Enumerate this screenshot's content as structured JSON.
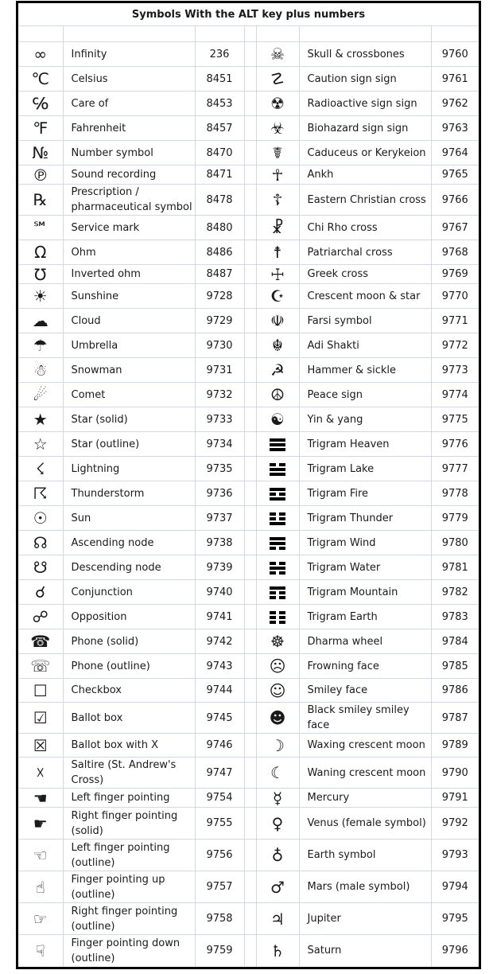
{
  "title": "Symbols With the ALT key plus numbers",
  "rows": [
    {
      "left": {
        "symbol": "∞",
        "icon": "infinity-icon",
        "name": "Infinity",
        "code": "236"
      },
      "right": {
        "symbol": "☠",
        "icon": "skull-crossbones-icon",
        "name": "Skull & crossbones",
        "code": "9760"
      }
    },
    {
      "left": {
        "symbol": "℃",
        "icon": "celsius-icon",
        "name": "Celsius",
        "code": "8451"
      },
      "right": {
        "symbol": "☡",
        "icon": "caution-sign-icon",
        "name": "Caution sign sign",
        "code": "9761"
      }
    },
    {
      "left": {
        "symbol": "℅",
        "icon": "care-of-icon",
        "name": "Care of",
        "code": "8453"
      },
      "right": {
        "symbol": "☢",
        "icon": "radioactive-icon",
        "name": "Radioactive sign sign",
        "code": "9762"
      }
    },
    {
      "left": {
        "symbol": "℉",
        "icon": "fahrenheit-icon",
        "name": "Fahrenheit",
        "code": "8457"
      },
      "right": {
        "symbol": "☣",
        "icon": "biohazard-icon",
        "name": "Biohazard sign sign",
        "code": "9763"
      }
    },
    {
      "left": {
        "symbol": "№",
        "icon": "number-symbol-icon",
        "name": "Number symbol",
        "code": "8470"
      },
      "right": {
        "symbol": "☤",
        "icon": "caduceus-icon",
        "name": "Caduceus or Kerykeion",
        "code": "9764"
      }
    },
    {
      "left": {
        "symbol": "℗",
        "icon": "sound-recording-icon",
        "name": "Sound recording",
        "code": "8471"
      },
      "right": {
        "symbol": "☥",
        "icon": "ankh-icon",
        "name": "Ankh",
        "code": "9765"
      }
    },
    {
      "left": {
        "symbol": "℞",
        "icon": "prescription-icon",
        "name": "Prescription / pharmaceutical symbol",
        "code": "8478"
      },
      "right": {
        "symbol": "☦",
        "icon": "eastern-christian-cross-icon",
        "name": "Eastern Christian cross",
        "code": "9766"
      }
    },
    {
      "left": {
        "symbol": "℠",
        "icon": "service-mark-icon",
        "name": "Service mark",
        "code": "8480"
      },
      "right": {
        "symbol": "☧",
        "icon": "chi-rho-icon",
        "name": "Chi Rho cross",
        "code": "9767"
      }
    },
    {
      "left": {
        "symbol": "Ω",
        "icon": "ohm-icon",
        "name": "Ohm",
        "code": "8486"
      },
      "right": {
        "symbol": "☨",
        "icon": "patriarchal-cross-icon",
        "name": "Patriarchal cross",
        "code": "9768"
      }
    },
    {
      "left": {
        "symbol": "℧",
        "icon": "inverted-ohm-icon",
        "name": "Inverted ohm",
        "code": "8487"
      },
      "right": {
        "symbol": "☩",
        "icon": "greek-cross-icon",
        "name": "Greek cross",
        "code": "9769"
      }
    },
    {
      "left": {
        "symbol": "☀",
        "icon": "sunshine-icon",
        "name": "Sunshine",
        "code": "9728"
      },
      "right": {
        "symbol": "☪",
        "icon": "crescent-moon-star-icon",
        "name": "Crescent moon & star",
        "code": "9770"
      }
    },
    {
      "left": {
        "symbol": "☁",
        "icon": "cloud-icon",
        "name": "Cloud",
        "code": "9729"
      },
      "right": {
        "symbol": "☫",
        "icon": "farsi-symbol-icon",
        "name": "Farsi symbol",
        "code": "9771"
      }
    },
    {
      "left": {
        "symbol": "☂",
        "icon": "umbrella-icon",
        "name": "Umbrella",
        "code": "9730"
      },
      "right": {
        "symbol": "☬",
        "icon": "adi-shakti-icon",
        "name": "Adi Shakti",
        "code": "9772"
      }
    },
    {
      "left": {
        "symbol": "☃",
        "icon": "snowman-icon",
        "name": "Snowman",
        "code": "9731"
      },
      "right": {
        "symbol": "☭",
        "icon": "hammer-sickle-icon",
        "name": "Hammer & sickle",
        "code": "9773"
      }
    },
    {
      "left": {
        "symbol": "☄",
        "icon": "comet-icon",
        "name": "Comet",
        "code": "9732"
      },
      "right": {
        "symbol": "☮",
        "icon": "peace-sign-icon",
        "name": "Peace sign",
        "code": "9774"
      }
    },
    {
      "left": {
        "symbol": "★",
        "icon": "star-solid-icon",
        "name": "Star (solid)",
        "code": "9733"
      },
      "right": {
        "symbol": "☯",
        "icon": "yin-yang-icon",
        "name": "Yin & yang",
        "code": "9775"
      }
    },
    {
      "left": {
        "symbol": "☆",
        "icon": "star-outline-icon",
        "name": "Star (outline)",
        "code": "9734"
      },
      "right": {
        "symbol": "☰",
        "icon": "trigram-heaven-icon",
        "name": "Trigram Heaven",
        "code": "9776",
        "trigram": "sss"
      }
    },
    {
      "left": {
        "symbol": "☇",
        "icon": "lightning-icon",
        "name": "Lightning",
        "code": "9735"
      },
      "right": {
        "symbol": "☱",
        "icon": "trigram-lake-icon",
        "name": "Trigram Lake",
        "code": "9777",
        "trigram": "bss"
      }
    },
    {
      "left": {
        "symbol": "☈",
        "icon": "thunderstorm-icon",
        "name": "Thunderstorm",
        "code": "9736"
      },
      "right": {
        "symbol": "☲",
        "icon": "trigram-fire-icon",
        "name": "Trigram Fire",
        "code": "9778",
        "trigram": "sbs"
      }
    },
    {
      "left": {
        "symbol": "☉",
        "icon": "sun-icon",
        "name": "Sun",
        "code": "9737"
      },
      "right": {
        "symbol": "☳",
        "icon": "trigram-thunder-icon",
        "name": "Trigram Thunder",
        "code": "9779",
        "trigram": "bbs"
      }
    },
    {
      "left": {
        "symbol": "☊",
        "icon": "ascending-node-icon",
        "name": "Ascending node",
        "code": "9738"
      },
      "right": {
        "symbol": "☴",
        "icon": "trigram-wind-icon",
        "name": "Trigram Wind",
        "code": "9780",
        "trigram": "ssb"
      }
    },
    {
      "left": {
        "symbol": "☋",
        "icon": "descending-node-icon",
        "name": "Descending node",
        "code": "9739"
      },
      "right": {
        "symbol": "☵",
        "icon": "trigram-water-icon",
        "name": "Trigram Water",
        "code": "9781",
        "trigram": "bsb"
      }
    },
    {
      "left": {
        "symbol": "☌",
        "icon": "conjunction-icon",
        "name": "Conjunction",
        "code": "9740"
      },
      "right": {
        "symbol": "☶",
        "icon": "trigram-mountain-icon",
        "name": "Trigram Mountain",
        "code": "9782",
        "trigram": "sbb"
      }
    },
    {
      "left": {
        "symbol": "☍",
        "icon": "opposition-icon",
        "name": "Opposition",
        "code": "9741"
      },
      "right": {
        "symbol": "☷",
        "icon": "trigram-earth-icon",
        "name": "Trigram Earth",
        "code": "9783",
        "trigram": "bbb"
      }
    },
    {
      "left": {
        "symbol": "☎",
        "icon": "phone-solid-icon",
        "name": "Phone (solid)",
        "code": "9742"
      },
      "right": {
        "symbol": "☸",
        "icon": "dharma-wheel-icon",
        "name": "Dharma wheel",
        "code": "9784"
      }
    },
    {
      "left": {
        "symbol": "☏",
        "icon": "phone-outline-icon",
        "name": "Phone (outline)",
        "code": "9743"
      },
      "right": {
        "symbol": "☹",
        "icon": "frowning-face-icon",
        "name": "Frowning face",
        "code": "9785"
      }
    },
    {
      "left": {
        "symbol": "☐",
        "icon": "checkbox-icon",
        "name": "Checkbox",
        "code": "9744"
      },
      "right": {
        "symbol": "☺",
        "icon": "smiley-face-icon",
        "name": "Smiley face",
        "code": "9786"
      }
    },
    {
      "left": {
        "symbol": "☑",
        "icon": "ballot-box-check-icon",
        "name": "Ballot box",
        "code": "9745"
      },
      "right": {
        "symbol": "☻",
        "icon": "black-smiley-face-icon",
        "name": "Black smiley smiley face",
        "code": "9787"
      }
    },
    {
      "left": {
        "symbol": "☒",
        "icon": "ballot-box-x-icon",
        "name": "Ballot box with X",
        "code": "9746"
      },
      "right": {
        "symbol": "☽",
        "icon": "waxing-crescent-moon-icon",
        "name": "Waxing crescent moon",
        "code": "9789"
      }
    },
    {
      "left": {
        "symbol": "☓",
        "icon": "saltire-icon",
        "name": "Saltire (St. Andrew's Cross)",
        "code": "9747"
      },
      "right": {
        "symbol": "☾",
        "icon": "waning-crescent-moon-icon",
        "name": "Waning crescent moon",
        "code": "9790"
      }
    },
    {
      "left": {
        "symbol": "☚",
        "icon": "left-finger-solid-icon",
        "name": "Left finger pointing",
        "code": "9754"
      },
      "right": {
        "symbol": "☿",
        "icon": "mercury-icon",
        "name": "Mercury",
        "code": "9791"
      }
    },
    {
      "left": {
        "symbol": "☛",
        "icon": "right-finger-solid-icon",
        "name": "Right finger pointing (solid)",
        "code": "9755"
      },
      "right": {
        "symbol": "♀",
        "icon": "venus-icon",
        "name": "Venus (female symbol)",
        "code": "9792"
      }
    },
    {
      "left": {
        "symbol": "☜",
        "icon": "left-finger-outline-icon",
        "name": "Left finger pointing (outline)",
        "code": "9756"
      },
      "right": {
        "symbol": "♁",
        "icon": "earth-symbol-icon",
        "name": "Earth symbol",
        "code": "9793"
      }
    },
    {
      "left": {
        "symbol": "☝",
        "icon": "finger-up-outline-icon",
        "name": "Finger pointing up (outline)",
        "code": "9757"
      },
      "right": {
        "symbol": "♂",
        "icon": "mars-icon",
        "name": "Mars (male symbol)",
        "code": "9794"
      }
    },
    {
      "left": {
        "symbol": "☞",
        "icon": "right-finger-outline-icon",
        "name": "Right finger pointing (outline)",
        "code": "9758"
      },
      "right": {
        "symbol": "♃",
        "icon": "jupiter-icon",
        "name": "Jupiter",
        "code": "9795"
      }
    },
    {
      "left": {
        "symbol": "☟",
        "icon": "finger-down-outline-icon",
        "name": "Finger pointing down (outline)",
        "code": "9759"
      },
      "right": {
        "symbol": "♄",
        "icon": "saturn-icon",
        "name": "Saturn",
        "code": "9796"
      }
    }
  ]
}
